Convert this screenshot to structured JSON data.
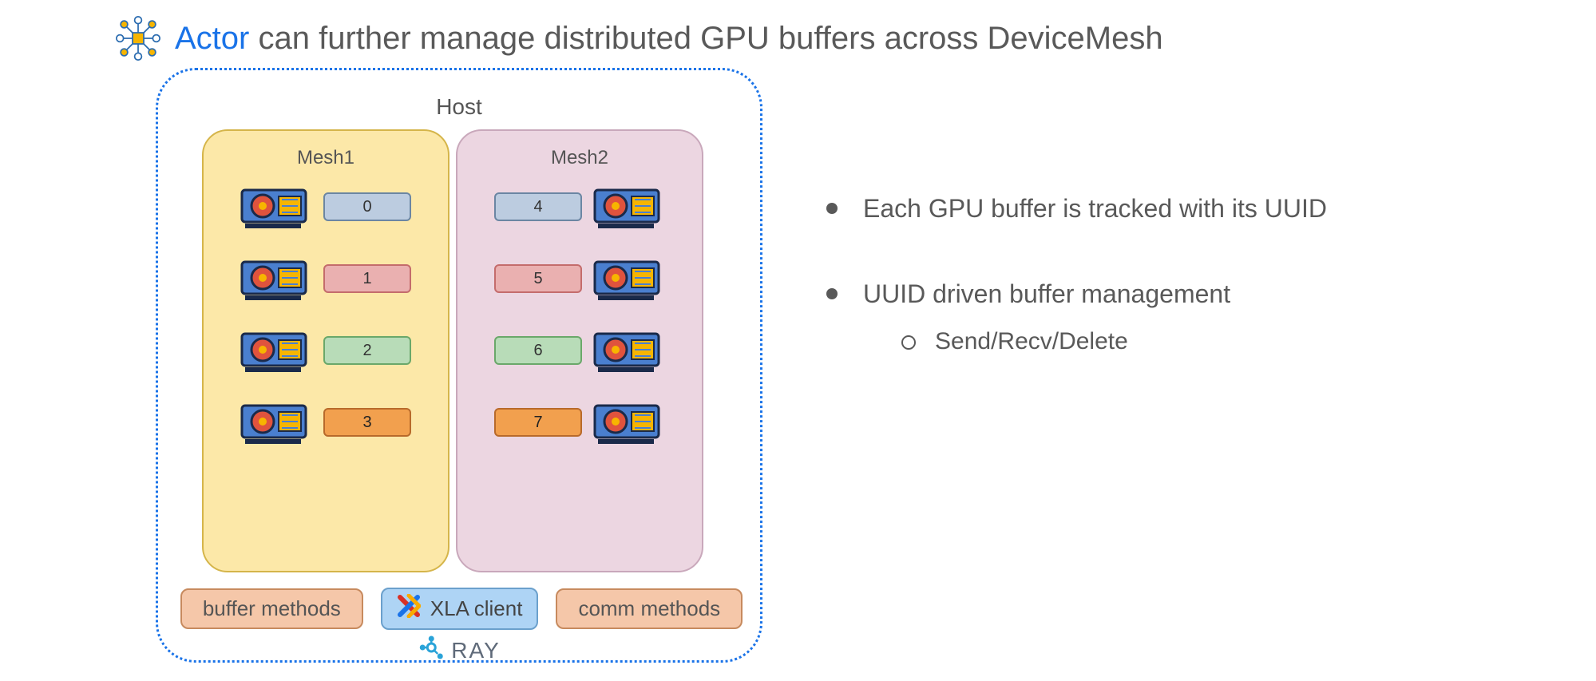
{
  "title": {
    "actor": "Actor",
    "rest": " can further manage distributed GPU buffers across DeviceMesh"
  },
  "diagram": {
    "host_label": "Host",
    "mesh1": {
      "label": "Mesh1",
      "buffers": [
        "0",
        "1",
        "2",
        "3"
      ]
    },
    "mesh2": {
      "label": "Mesh2",
      "buffers": [
        "4",
        "5",
        "6",
        "7"
      ]
    },
    "bottom": {
      "buffer_methods": "buffer methods",
      "xla_client": "XLA client",
      "comm_methods": "comm methods",
      "ray": "RAY"
    }
  },
  "bullets": {
    "b1": "Each GPU buffer is tracked with its UUID",
    "b2": "UUID driven buffer management",
    "b2a": "Send/Recv/Delete"
  },
  "colors": {
    "accent": "#1a73e8",
    "chip_buffer0": "#bccce0",
    "chip_buffer1": "#eab0b0",
    "chip_buffer2": "#b8dcb8",
    "chip_buffer3": "#f2a04e"
  }
}
